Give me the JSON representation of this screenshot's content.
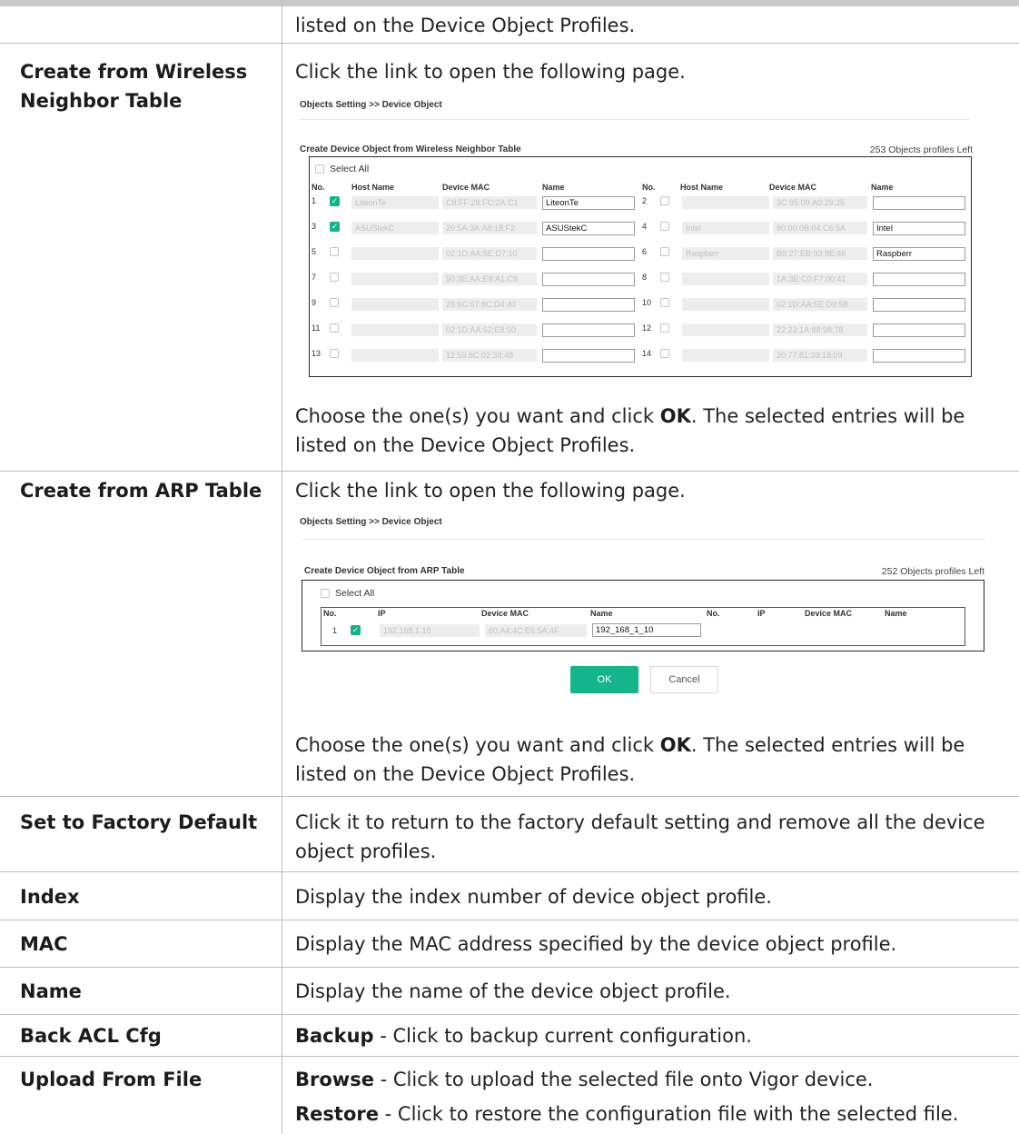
{
  "rows": [
    {
      "label": "",
      "text": "listed on the Device Object Profiles."
    },
    {
      "label": "Create from Wireless Neighbor Table",
      "intro": "Click the link to open the following page.",
      "after": "Choose the one(s) you want and click ",
      "after_bold": "OK",
      "after_rest": ". The selected entries will be listed on the Device Object Profiles."
    },
    {
      "label": "Create from ARP Table",
      "intro": "Click the link to open the following page.",
      "after": "Choose the one(s) you want and click ",
      "after_bold": "OK",
      "after_rest": ". The selected entries will be listed on the Device Object Profiles."
    },
    {
      "label": "Set to Factory Default",
      "text": "Click it to return to the factory default setting and remove all the device object profiles."
    },
    {
      "label": "Index",
      "text": "Display the index number of device object profile."
    },
    {
      "label": "MAC",
      "text": "Display the MAC address specified by the device object profile."
    },
    {
      "label": "Name",
      "text": "Display the name of the device object profile."
    },
    {
      "label": "Back ACL Cfg",
      "bold": "Backup",
      "text": " - Click to backup current configuration."
    },
    {
      "label": "Upload From File",
      "bold": "Browse",
      "text": " - Click to upload the selected file onto Vigor device.",
      "bold2": "Restore",
      "text2": " - Click to restore the configuration file with the selected file."
    }
  ],
  "wireless": {
    "breadcrumb": "Objects Setting >> Device Object",
    "title": "Create Device Object from Wireless Neighbor Table",
    "left": "253 Objects profiles Left",
    "select_all": "Select All",
    "headers": {
      "no": "No.",
      "host": "Host Name",
      "mac": "Device MAC",
      "name": "Name"
    },
    "entries": [
      {
        "no": "1",
        "checked": true,
        "host": "LiteonTe",
        "mac": "C8:FF:28:FC:2A:C1",
        "name": "LiteonTe"
      },
      {
        "no": "2",
        "checked": false,
        "host": "",
        "mac": "3C:95:09:A0:29:25",
        "name": ""
      },
      {
        "no": "3",
        "checked": true,
        "host": "ASUStekC",
        "mac": "20:5A:3A:A8:18:F2",
        "name": "ASUStekC"
      },
      {
        "no": "4",
        "checked": false,
        "host": "Intel",
        "mac": "80:00:0B:04:C6:5A",
        "name": "Intel"
      },
      {
        "no": "5",
        "checked": false,
        "host": "",
        "mac": "02:1D:AA:5E:D7:10",
        "name": ""
      },
      {
        "no": "6",
        "checked": false,
        "host": "Raspberr",
        "mac": "B8:27:EB:93:8E:46",
        "name": "Raspberr"
      },
      {
        "no": "7",
        "checked": false,
        "host": "",
        "mac": "50:3E:AA:E8:A1:C9",
        "name": ""
      },
      {
        "no": "8",
        "checked": false,
        "host": "",
        "mac": "1A:3E:C0:F7:00:41",
        "name": ""
      },
      {
        "no": "9",
        "checked": false,
        "host": "",
        "mac": "28:6C:07:8C:D4:40",
        "name": ""
      },
      {
        "no": "10",
        "checked": false,
        "host": "",
        "mac": "02:1D:AA:5E:D9:58",
        "name": ""
      },
      {
        "no": "11",
        "checked": false,
        "host": "",
        "mac": "02:1D:AA:62:E8:50",
        "name": ""
      },
      {
        "no": "12",
        "checked": false,
        "host": "",
        "mac": "22:23:1A:88:98:78",
        "name": ""
      },
      {
        "no": "13",
        "checked": false,
        "host": "",
        "mac": "12:59:8C:02:38:48",
        "name": ""
      },
      {
        "no": "14",
        "checked": false,
        "host": "",
        "mac": "20:77:81:33:18:09",
        "name": ""
      }
    ]
  },
  "arp": {
    "breadcrumb": "Objects Setting >> Device Object",
    "title": "Create Device Object from ARP Table",
    "left": "252 Objects profiles Left",
    "select_all": "Select All",
    "headers": {
      "no": "No.",
      "ip": "IP",
      "mac": "Device MAC",
      "name": "Name"
    },
    "entries": [
      {
        "no": "1",
        "checked": true,
        "ip": "192.168.1.10",
        "mac": "60:A4:4C:E6:5A:4F",
        "name": "192_168_1_10"
      }
    ],
    "ok": "OK",
    "cancel": "Cancel"
  },
  "colors": {
    "accent": "#17b08b",
    "border": "#bdbdbd"
  }
}
